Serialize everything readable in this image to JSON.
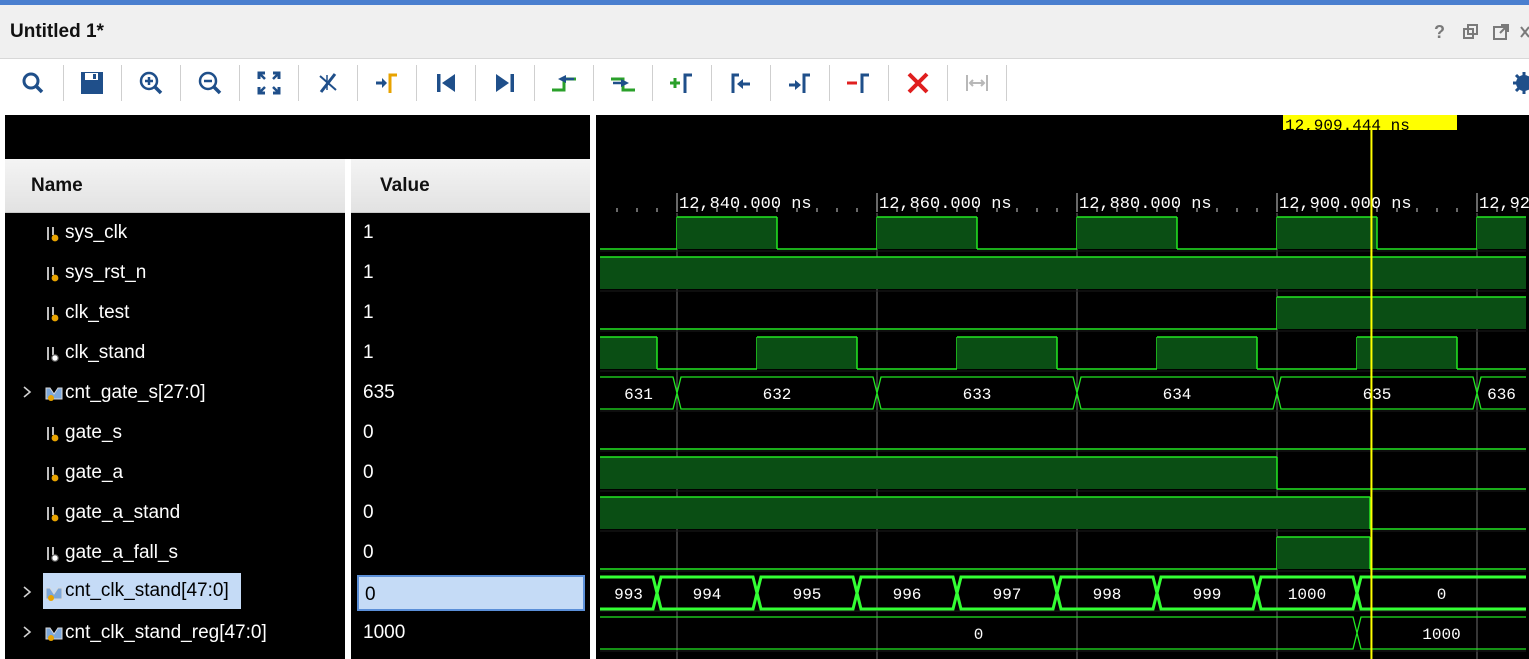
{
  "window": {
    "title": "Untitled 1*",
    "controls": [
      "help-icon",
      "restore-icon",
      "float-icon",
      "close-icon"
    ]
  },
  "toolbar": {
    "buttons": [
      {
        "name": "search-icon"
      },
      {
        "name": "save-icon"
      },
      {
        "name": "zoom-in-icon"
      },
      {
        "name": "zoom-out-icon"
      },
      {
        "name": "zoom-fit-icon"
      },
      {
        "name": "cursor-to-zero-icon"
      },
      {
        "name": "go-to-time-icon"
      },
      {
        "name": "go-to-start-icon"
      },
      {
        "name": "go-to-end-icon"
      },
      {
        "name": "previous-transition-icon"
      },
      {
        "name": "next-transition-icon"
      },
      {
        "name": "add-marker-icon"
      },
      {
        "name": "previous-marker-icon"
      },
      {
        "name": "next-marker-icon"
      },
      {
        "name": "swap-cursors-icon"
      },
      {
        "name": "delete-icon"
      },
      {
        "name": "snap-to-transition-icon"
      }
    ],
    "settings_icon": "gear-icon"
  },
  "columns": {
    "name": "Name",
    "value": "Value"
  },
  "signals": [
    {
      "name": "sys_clk",
      "value": "1",
      "bus": false,
      "icon": "port-icon",
      "selected": false
    },
    {
      "name": "sys_rst_n",
      "value": "1",
      "bus": false,
      "icon": "port-icon",
      "selected": false
    },
    {
      "name": "clk_test",
      "value": "1",
      "bus": false,
      "icon": "port-icon",
      "selected": false
    },
    {
      "name": "clk_stand",
      "value": "1",
      "bus": false,
      "icon": "internal-signal-icon",
      "selected": false
    },
    {
      "name": "cnt_gate_s[27:0]",
      "value": "635",
      "bus": true,
      "icon": "bus-icon",
      "selected": false
    },
    {
      "name": "gate_s",
      "value": "0",
      "bus": false,
      "icon": "port-icon",
      "selected": false
    },
    {
      "name": "gate_a",
      "value": "0",
      "bus": false,
      "icon": "port-icon",
      "selected": false
    },
    {
      "name": "gate_a_stand",
      "value": "0",
      "bus": false,
      "icon": "port-icon",
      "selected": false
    },
    {
      "name": "gate_a_fall_s",
      "value": "0",
      "bus": false,
      "icon": "internal-signal-icon",
      "selected": false
    },
    {
      "name": "cnt_clk_stand[47:0]",
      "value": "0",
      "bus": true,
      "icon": "bus-icon",
      "selected": true
    },
    {
      "name": "cnt_clk_stand_reg[47:0]",
      "value": "1000",
      "bus": true,
      "icon": "bus-icon",
      "selected": false
    }
  ],
  "cursor": {
    "label": "12,909.444 ns",
    "time": 12909.444
  },
  "timescale": {
    "ticks": [
      {
        "t": 12840,
        "label": "12,840.000 ns"
      },
      {
        "t": 12860,
        "label": "12,860.000 ns"
      },
      {
        "t": 12880,
        "label": "12,880.000 ns"
      },
      {
        "t": 12900,
        "label": "12,900.000 ns"
      },
      {
        "t": 12920,
        "label": "12,92"
      }
    ]
  },
  "colors": {
    "wave": "#22e822",
    "wave_fill": "#0a4e14",
    "cursor": "#ffff00",
    "bus_highlight": "#33ff33",
    "selection": "#c5dbf6",
    "grid": "#6b6b6b"
  },
  "waves": {
    "sys_clk": {
      "kind": "bit",
      "init": 0,
      "edges": [
        12840,
        12850,
        12860,
        12870,
        12880,
        12890,
        12900,
        12910,
        12920
      ]
    },
    "sys_rst_n": {
      "kind": "bit",
      "init": 1,
      "edges": []
    },
    "clk_test": {
      "kind": "bit",
      "init": 0,
      "edges": [
        12900
      ]
    },
    "clk_stand": {
      "kind": "bit",
      "init": 1,
      "edges": [
        12824,
        12838,
        12848,
        12858,
        12868,
        12878,
        12888,
        12898,
        12908,
        12918,
        12928
      ]
    },
    "cnt_gate_s": {
      "kind": "bus",
      "segments": [
        {
          "start": 12824,
          "end": 12840,
          "value": "631"
        },
        {
          "start": 12840,
          "end": 12860,
          "value": "632"
        },
        {
          "start": 12860,
          "end": 12880,
          "value": "633"
        },
        {
          "start": 12880,
          "end": 12900,
          "value": "634"
        },
        {
          "start": 12900,
          "end": 12920,
          "value": "635"
        },
        {
          "start": 12920,
          "end": 12930,
          "value": "636"
        }
      ]
    },
    "gate_s": {
      "kind": "bit",
      "init": 0,
      "edges": []
    },
    "gate_a": {
      "kind": "bit",
      "init": 1,
      "edges": [
        12900
      ]
    },
    "gate_a_stand": {
      "kind": "bit",
      "init": 1,
      "edges": [
        12909.3
      ]
    },
    "gate_a_fall_s": {
      "kind": "bit",
      "init": 0,
      "edges": [
        12900,
        12909.3
      ]
    },
    "cnt_clk_stand": {
      "kind": "bus",
      "highlight": true,
      "segments": [
        {
          "start": 12824,
          "end": 12838,
          "value": "993"
        },
        {
          "start": 12838,
          "end": 12848,
          "value": "994"
        },
        {
          "start": 12848,
          "end": 12858,
          "value": "995"
        },
        {
          "start": 12858,
          "end": 12868,
          "value": "996"
        },
        {
          "start": 12868,
          "end": 12878,
          "value": "997"
        },
        {
          "start": 12878,
          "end": 12888,
          "value": "998"
        },
        {
          "start": 12888,
          "end": 12898,
          "value": "999"
        },
        {
          "start": 12898,
          "end": 12908,
          "value": "1000"
        },
        {
          "start": 12908,
          "end": 12930,
          "value": "0"
        }
      ]
    },
    "cnt_clk_stand_reg": {
      "kind": "bus",
      "segments": [
        {
          "start": 12824,
          "end": 12908,
          "value": "0"
        },
        {
          "start": 12908,
          "end": 12930,
          "value": "1000"
        }
      ]
    }
  }
}
